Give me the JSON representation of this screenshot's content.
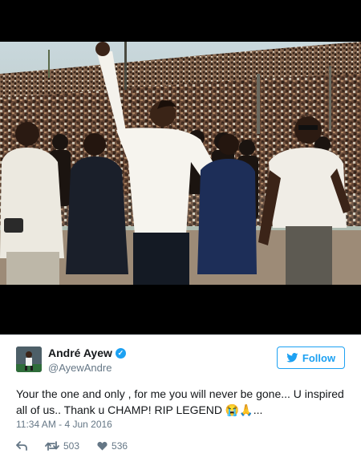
{
  "tweet": {
    "author_name": "André Ayew",
    "handle": "@AyewAndre",
    "follow_label": "Follow",
    "text": "Your the one and only , for me you will never be gone... U inspired all of us.. Thank u CHAMP! RIP LEGEND 😭🙏...",
    "timestamp": "11:34 AM - 4 Jun 2016",
    "retweet_count": "503",
    "like_count": "536"
  },
  "colors": {
    "accent": "#1da1f2",
    "secondary_text": "#657786",
    "primary_text": "#14171a"
  },
  "icons": {
    "verified": "verified-badge-icon",
    "follow": "twitter-bird-icon",
    "reply": "reply-arrow-icon",
    "retweet": "retweet-icon",
    "like": "heart-icon"
  }
}
